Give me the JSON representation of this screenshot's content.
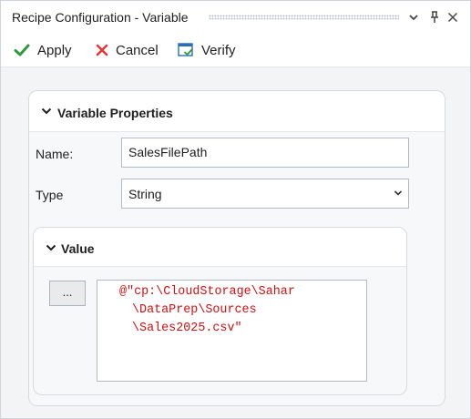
{
  "window": {
    "title": "Recipe Configuration - Variable",
    "controls": {
      "dropdown_icon": "chevron-down-icon",
      "pin_icon": "pin-icon",
      "close_icon": "close-icon"
    }
  },
  "toolbar": {
    "apply_label": "Apply",
    "apply_icon": "checkmark-icon",
    "apply_color": "#2e9a3e",
    "cancel_label": "Cancel",
    "cancel_icon": "x-icon",
    "cancel_color": "#e03a3a",
    "verify_label": "Verify",
    "verify_icon": "verify-window-icon",
    "verify_color": "#2a6ebb"
  },
  "variable_properties": {
    "title": "Variable Properties",
    "name_label": "Name:",
    "name_value": "SalesFilePath",
    "type_label": "Type",
    "type_value": "String"
  },
  "value_section": {
    "title": "Value",
    "browse_label": "...",
    "code_lines": [
      "@\"cp:\\CloudStorage\\Sahar",
      "\\DataPrep\\Sources",
      "\\Sales2025.csv\""
    ],
    "code_color": "#d01010"
  }
}
